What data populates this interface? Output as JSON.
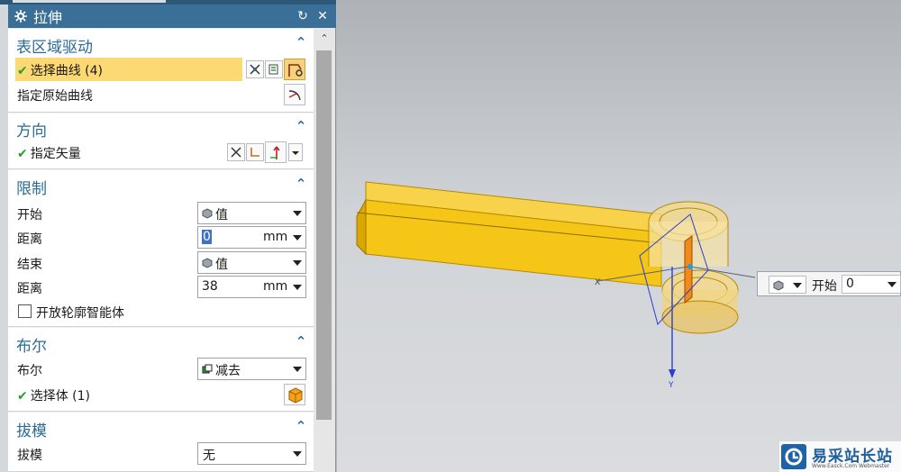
{
  "dialog": {
    "title": "拉伸",
    "sections": {
      "surface_region": {
        "title": "表区域驱动",
        "select_curve_label": "选择曲线 (4)",
        "specify_original_label": "指定原始曲线"
      },
      "direction": {
        "title": "方向",
        "specify_vector_label": "指定矢量"
      },
      "limits": {
        "title": "限制",
        "start_label": "开始",
        "start_option": "值",
        "start_distance_label": "距离",
        "start_distance_value": "0",
        "start_unit": "mm",
        "end_label": "结束",
        "end_option": "值",
        "end_distance_label": "距离",
        "end_distance_value": "38",
        "end_unit": "mm",
        "open_profile_label": "开放轮廓智能体"
      },
      "boolean": {
        "title": "布尔",
        "boolean_label": "布尔",
        "boolean_option": "减去",
        "select_body_label": "选择体 (1)"
      },
      "draft": {
        "title": "拔模",
        "draft_label": "拔模",
        "draft_option": "无"
      }
    }
  },
  "viewport": {
    "handle": {
      "label": "开始",
      "value": "0"
    },
    "axes": {
      "x_label": "X",
      "y_label": "Y"
    }
  },
  "watermark": {
    "text": "易采站长站",
    "sub": "Www.Easck.Com Webmaster"
  },
  "colors": {
    "title_bar": "#3a6f97",
    "section_title": "#2b6b96",
    "highlight": "#fcd972",
    "model_yellow": "#f5c518"
  }
}
